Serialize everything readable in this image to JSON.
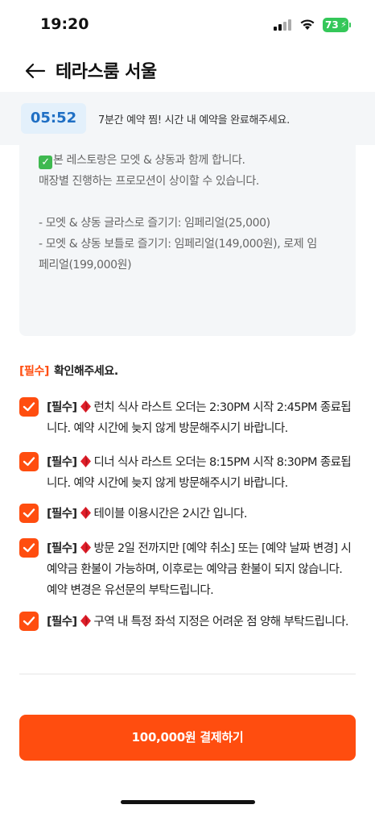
{
  "status_bar": {
    "time": "19:20",
    "battery": "73"
  },
  "header": {
    "back_icon": "arrow-left-icon",
    "title": "테라스룸 서울"
  },
  "timer": {
    "countdown": "05:52",
    "message": "7분간 예약 찜! 시간 내 예약을 완료해주세요."
  },
  "notice": {
    "line1": "본 레스토랑은 모엣 & 샹동과 함께 합니다.",
    "line2": "매장별 진행하는 프로모션이 상이할 수 있습니다.",
    "line3": "- 모엣 & 샹동 글라스로 즐기기: 임페리얼(25,000)",
    "line4": "- 모엣 & 샹동 보틀로 즐기기: 임페리얼(149,000원), 로제 임",
    "line5": "페리얼(199,000원)"
  },
  "confirm": {
    "required_tag": "[필수]",
    "heading": "확인해주세요."
  },
  "agreements": [
    {
      "tag": "[필수]",
      "text": "런치 식사 라스트 오더는 2:30PM 시작 2:45PM 종료됩니다. 예약 시간에 늦지 않게 방문해주시기 바랍니다.",
      "checked": true
    },
    {
      "tag": "[필수]",
      "text": "디너 식사 라스트 오더는 8:15PM 시작 8:30PM 종료됩니다. 예약 시간에 늦지 않게 방문해주시기 바랍니다.",
      "checked": true
    },
    {
      "tag": "[필수]",
      "text": "테이블 이용시간은 2시간 입니다.",
      "checked": true
    },
    {
      "tag": "[필수]",
      "text": "방문 2일 전까지만 [예약 취소] 또는 [예약 날짜 변경] 시 예약금 환불이 가능하며, 이후로는 예약금 환불이 되지 않습니다. 예약 변경은 유선문의 부탁드립니다.",
      "checked": true
    },
    {
      "tag": "[필수]",
      "text": "구역 내 특정 좌석 지정은 어려운 점 양해 부탁드립니다.",
      "checked": true
    }
  ],
  "colors": {
    "accent": "#ff4d0f",
    "timer_text": "#1f6fc4",
    "check_emoji": "#3fb950",
    "diamond": "#e0202b"
  },
  "pay_button": {
    "label": "100,000원 결제하기"
  }
}
